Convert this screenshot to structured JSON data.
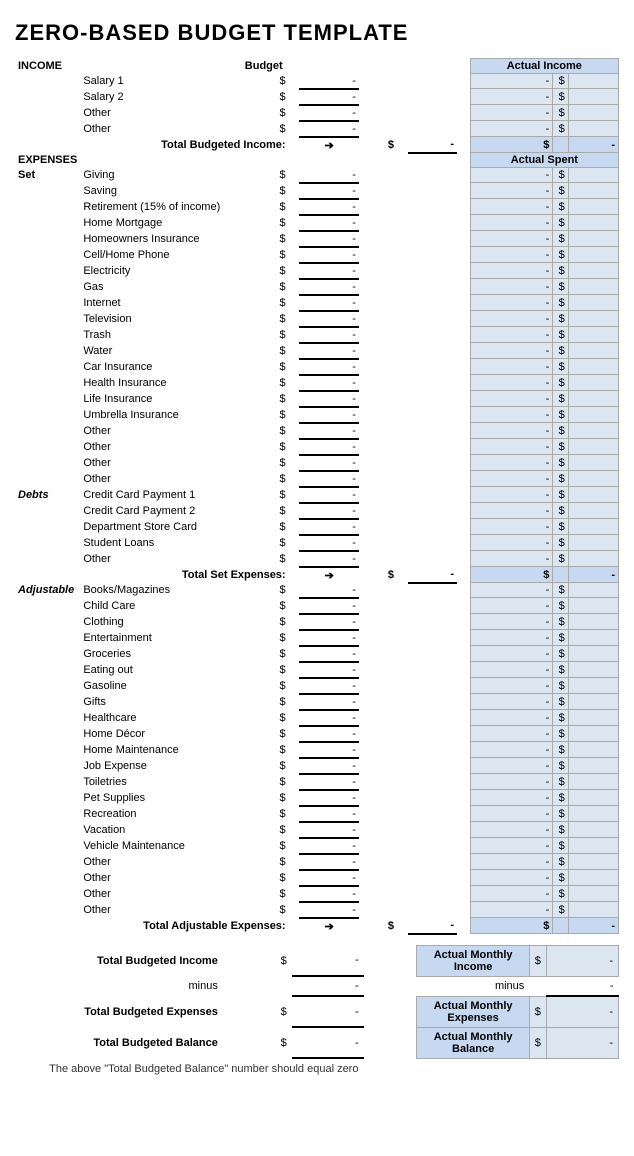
{
  "title": "ZERO-BASED BUDGET TEMPLATE",
  "sections": {
    "income": {
      "label": "INCOME",
      "budget_header": "Budget",
      "actual_header": "Actual Income",
      "rows": [
        {
          "label": "Salary 1"
        },
        {
          "label": "Salary 2"
        },
        {
          "label": "Other"
        },
        {
          "label": "Other"
        }
      ],
      "total_label": "Total Budgeted Income:",
      "dollar": "$",
      "dash": "-"
    },
    "expenses": {
      "label": "EXPENSES",
      "actual_header": "Actual Spent",
      "set": {
        "label": "Set",
        "rows": [
          {
            "label": "Giving"
          },
          {
            "label": "Saving"
          },
          {
            "label": "Retirement (15% of income)"
          },
          {
            "label": "Home Mortgage"
          },
          {
            "label": "Homeowners Insurance"
          },
          {
            "label": "Cell/Home Phone"
          },
          {
            "label": "Electricity"
          },
          {
            "label": "Gas"
          },
          {
            "label": "Internet"
          },
          {
            "label": "Television"
          },
          {
            "label": "Trash"
          },
          {
            "label": "Water"
          },
          {
            "label": "Car Insurance"
          },
          {
            "label": "Health Insurance"
          },
          {
            "label": "Life Insurance"
          },
          {
            "label": "Umbrella Insurance"
          },
          {
            "label": "Other"
          },
          {
            "label": "Other"
          },
          {
            "label": "Other"
          },
          {
            "label": "Other"
          }
        ]
      },
      "debts": {
        "label": "Debts",
        "rows": [
          {
            "label": "Credit Card Payment 1"
          },
          {
            "label": "Credit Card Payment 2"
          },
          {
            "label": "Department Store Card"
          },
          {
            "label": "Student Loans"
          },
          {
            "label": "Other"
          }
        ],
        "total_label": "Total Set Expenses:"
      },
      "adjustable": {
        "label": "Adjustable",
        "rows": [
          {
            "label": "Books/Magazines"
          },
          {
            "label": "Child Care"
          },
          {
            "label": "Clothing"
          },
          {
            "label": "Entertainment"
          },
          {
            "label": "Groceries"
          },
          {
            "label": "Eating out"
          },
          {
            "label": "Gasoline"
          },
          {
            "label": "Gifts"
          },
          {
            "label": "Healthcare"
          },
          {
            "label": "Home Décor"
          },
          {
            "label": "Home Maintenance"
          },
          {
            "label": "Job Expense"
          },
          {
            "label": "Toiletries"
          },
          {
            "label": "Pet Supplies"
          },
          {
            "label": "Recreation"
          },
          {
            "label": "Vacation"
          },
          {
            "label": "Vehicle Maintenance"
          },
          {
            "label": "Other"
          },
          {
            "label": "Other"
          },
          {
            "label": "Other"
          },
          {
            "label": "Other"
          }
        ],
        "total_label": "Total Adjustable Expenses:"
      }
    },
    "summary": {
      "total_budgeted_income": "Total Budgeted Income",
      "minus": "minus",
      "total_budgeted_expenses": "Total Budgeted Expenses",
      "total_budgeted_balance": "Total Budgeted Balance",
      "actual_monthly_income": "Actual Monthly Income",
      "actual_monthly_expenses": "Actual Monthly Expenses",
      "actual_monthly_balance": "Actual Monthly Balance",
      "note": "The above \"Total Budgeted Balance\" number should equal zero"
    }
  }
}
